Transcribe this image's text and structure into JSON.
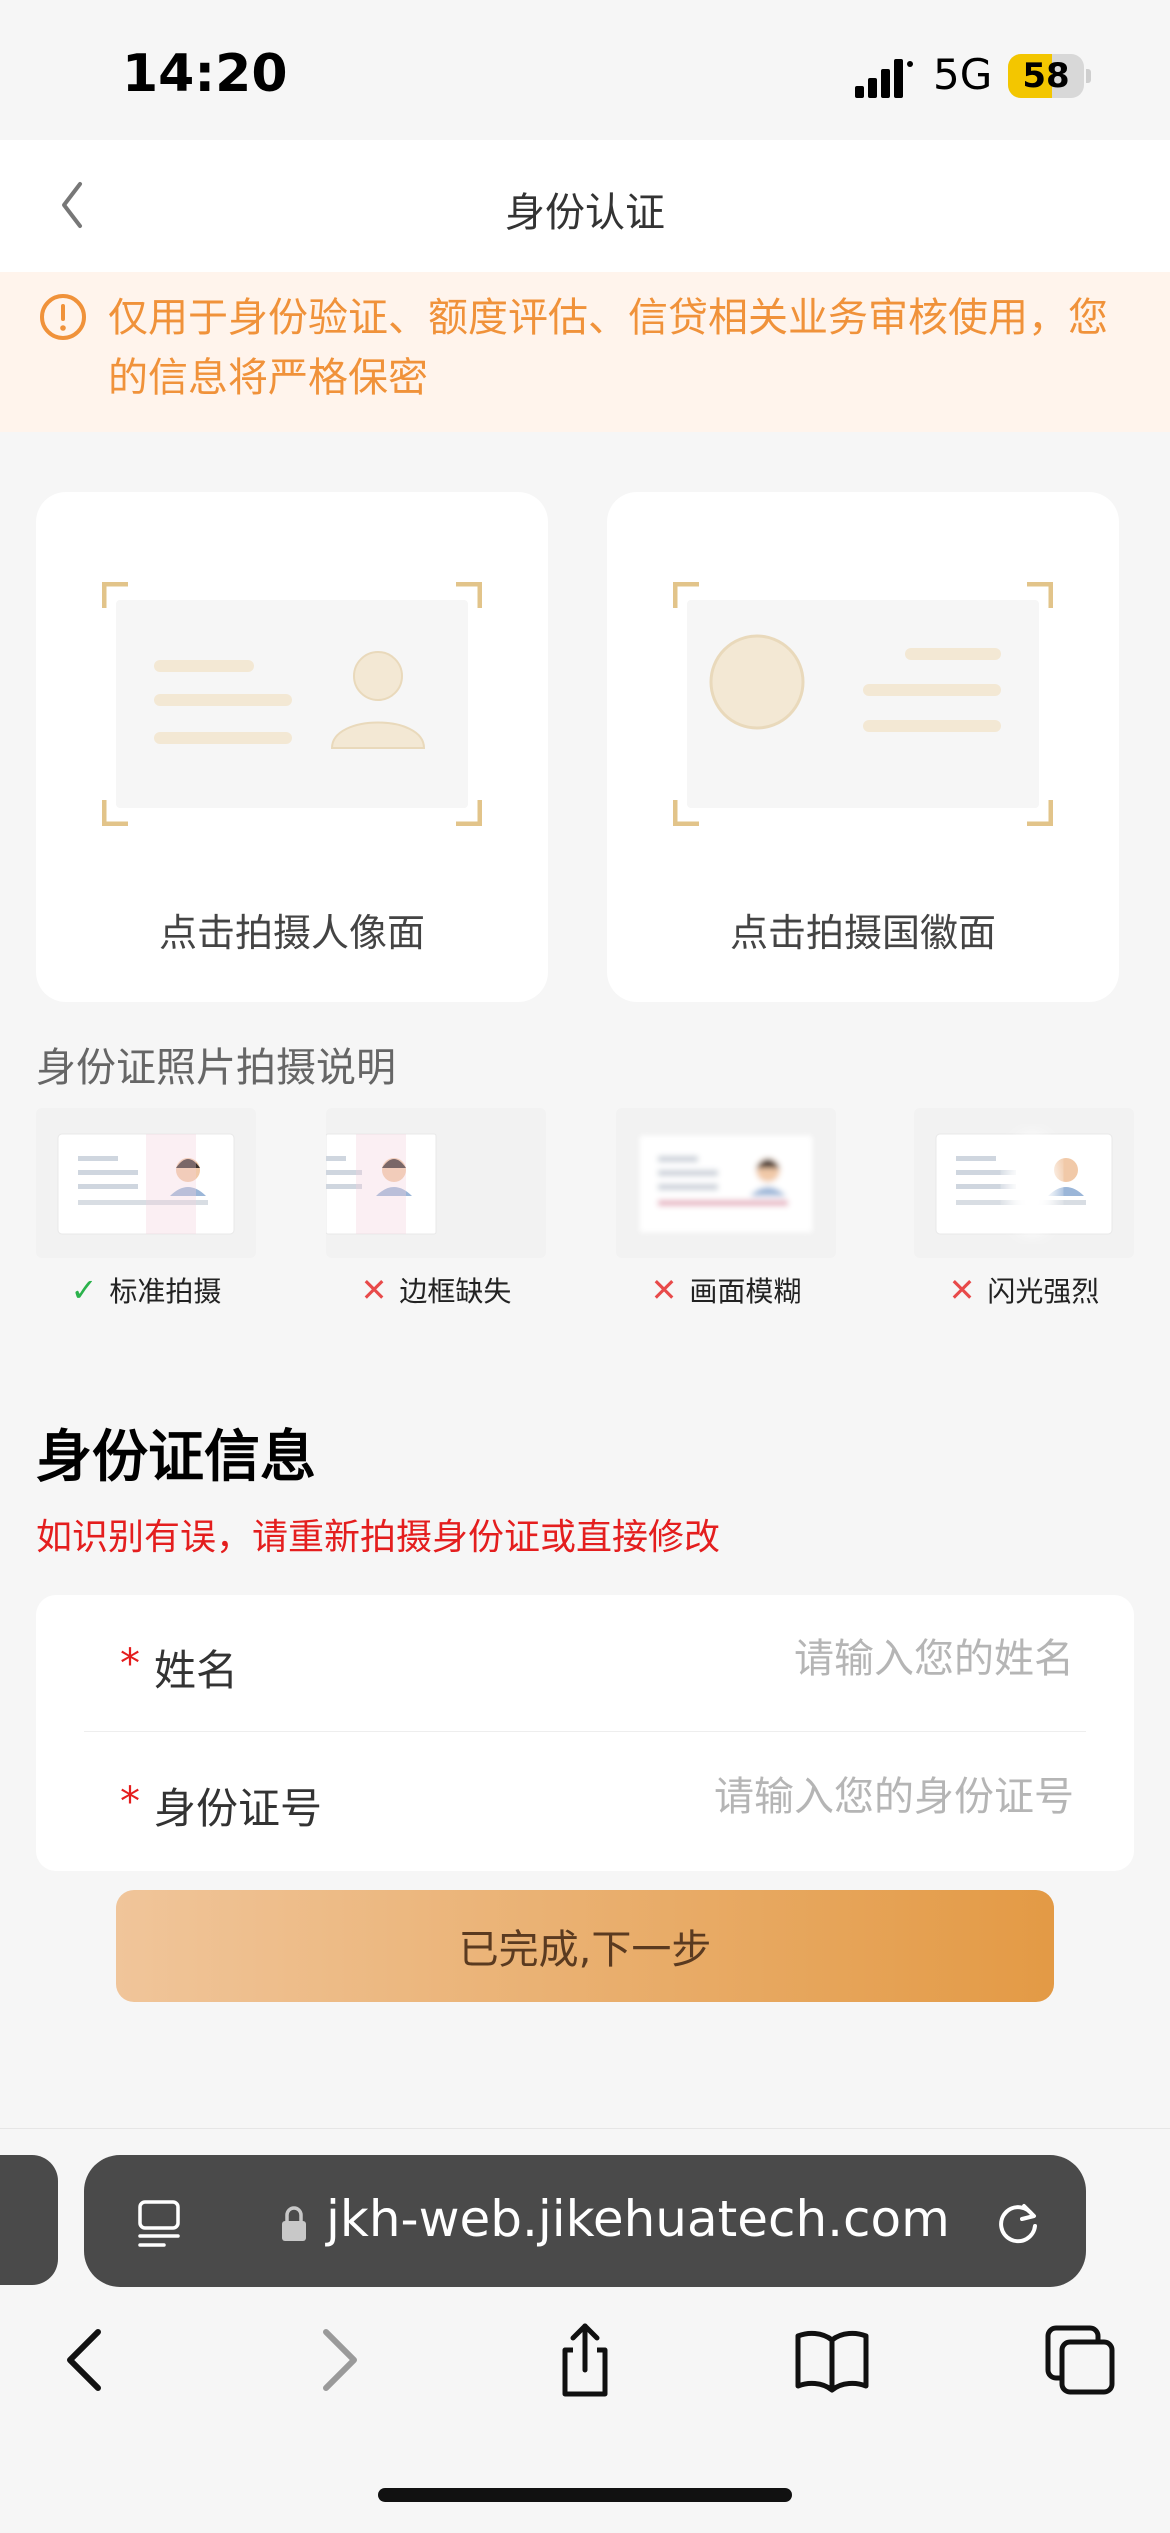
{
  "status": {
    "time": "14:20",
    "network": "5G",
    "battery": "58",
    "battery_level": 0.58
  },
  "nav": {
    "title": "身份认证"
  },
  "notice": {
    "text": "仅用于身份验证、额度评估、信贷相关业务审核使用，您的信息将严格保密"
  },
  "cards": [
    {
      "label": "点击拍摄人像面"
    },
    {
      "label": "点击拍摄国徽面"
    }
  ],
  "guide": {
    "title": "身份证照片拍摄说明",
    "items": [
      {
        "label": "标准拍摄",
        "ok": true
      },
      {
        "label": "边框缺失",
        "ok": false
      },
      {
        "label": "画面模糊",
        "ok": false
      },
      {
        "label": "闪光强烈",
        "ok": false
      }
    ]
  },
  "info": {
    "title": "身份证信息",
    "hint": "如识别有误，请重新拍摄身份证或直接修改",
    "fields": [
      {
        "label": "姓名",
        "value": "",
        "placeholder": "请输入您的姓名"
      },
      {
        "label": "身份证号",
        "value": "",
        "placeholder": "请输入您的身份证号"
      }
    ],
    "required_mark": "*"
  },
  "submit": {
    "label": "已完成,下一步"
  },
  "browser": {
    "url": "jkh-web.jikehuatech.com"
  },
  "colors": {
    "accent": "#f0923a",
    "error": "#e41e1e",
    "frame": "#e2c48a"
  }
}
